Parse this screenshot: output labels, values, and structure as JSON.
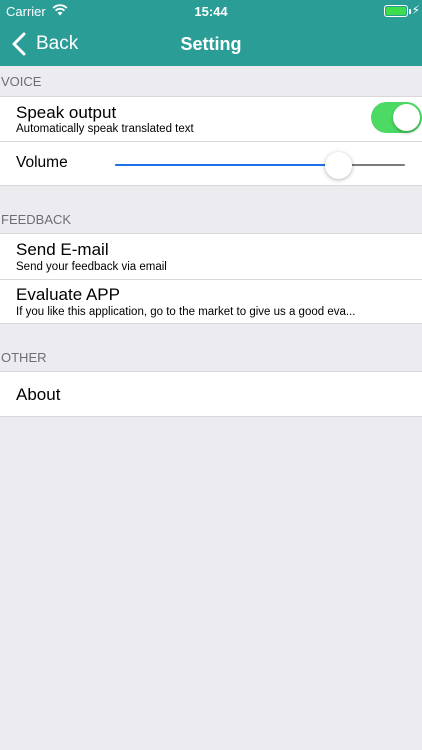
{
  "status_bar": {
    "carrier": "Carrier",
    "time": "15:44",
    "wifi_icon": "wifi-icon",
    "battery_icon": "battery-icon",
    "charging_icon": "bolt-icon"
  },
  "navbar": {
    "back_label": "Back",
    "title": "Setting",
    "background": "#2a9d97"
  },
  "sections": {
    "voice": {
      "header": "VOICE",
      "speak_output": {
        "title": "Speak output",
        "subtitle": "Automatically speak translated text",
        "enabled": true,
        "toggle_color": "#4cd964"
      },
      "volume": {
        "label": "Volume",
        "value": 0.77,
        "fill_color": "#1f6fe6"
      }
    },
    "feedback": {
      "header": "FEEDBACK",
      "send_email": {
        "title": "Send E-mail",
        "subtitle": "Send your feedback via email"
      },
      "evaluate": {
        "title": "Evaluate APP",
        "subtitle": "If you like this application, go to the market to give us a good eva..."
      }
    },
    "other": {
      "header": "OTHER",
      "about": {
        "title": "About"
      }
    }
  }
}
